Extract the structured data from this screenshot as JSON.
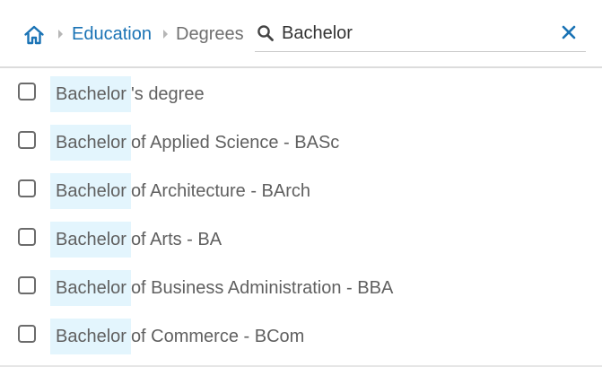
{
  "breadcrumb": {
    "home_icon": "home-icon",
    "items": [
      "Education",
      "Degrees"
    ]
  },
  "search": {
    "value": "Bachelor",
    "icon": "search-icon",
    "clear_icon": "close-icon"
  },
  "results": [
    {
      "match": "Bachelor",
      "rest": "'s degree",
      "checked": false
    },
    {
      "match": "Bachelor",
      "rest": " of Applied Science - BASc",
      "checked": false
    },
    {
      "match": "Bachelor",
      "rest": " of Architecture - BArch",
      "checked": false
    },
    {
      "match": "Bachelor",
      "rest": " of Arts - BA",
      "checked": false
    },
    {
      "match": "Bachelor",
      "rest": " of Business Administration - BBA",
      "checked": false
    },
    {
      "match": "Bachelor",
      "rest": " of Commerce - BCom",
      "checked": false
    }
  ],
  "colors": {
    "accent": "#1a73b5",
    "highlight": "#e3f5fd",
    "text": "#606060"
  }
}
